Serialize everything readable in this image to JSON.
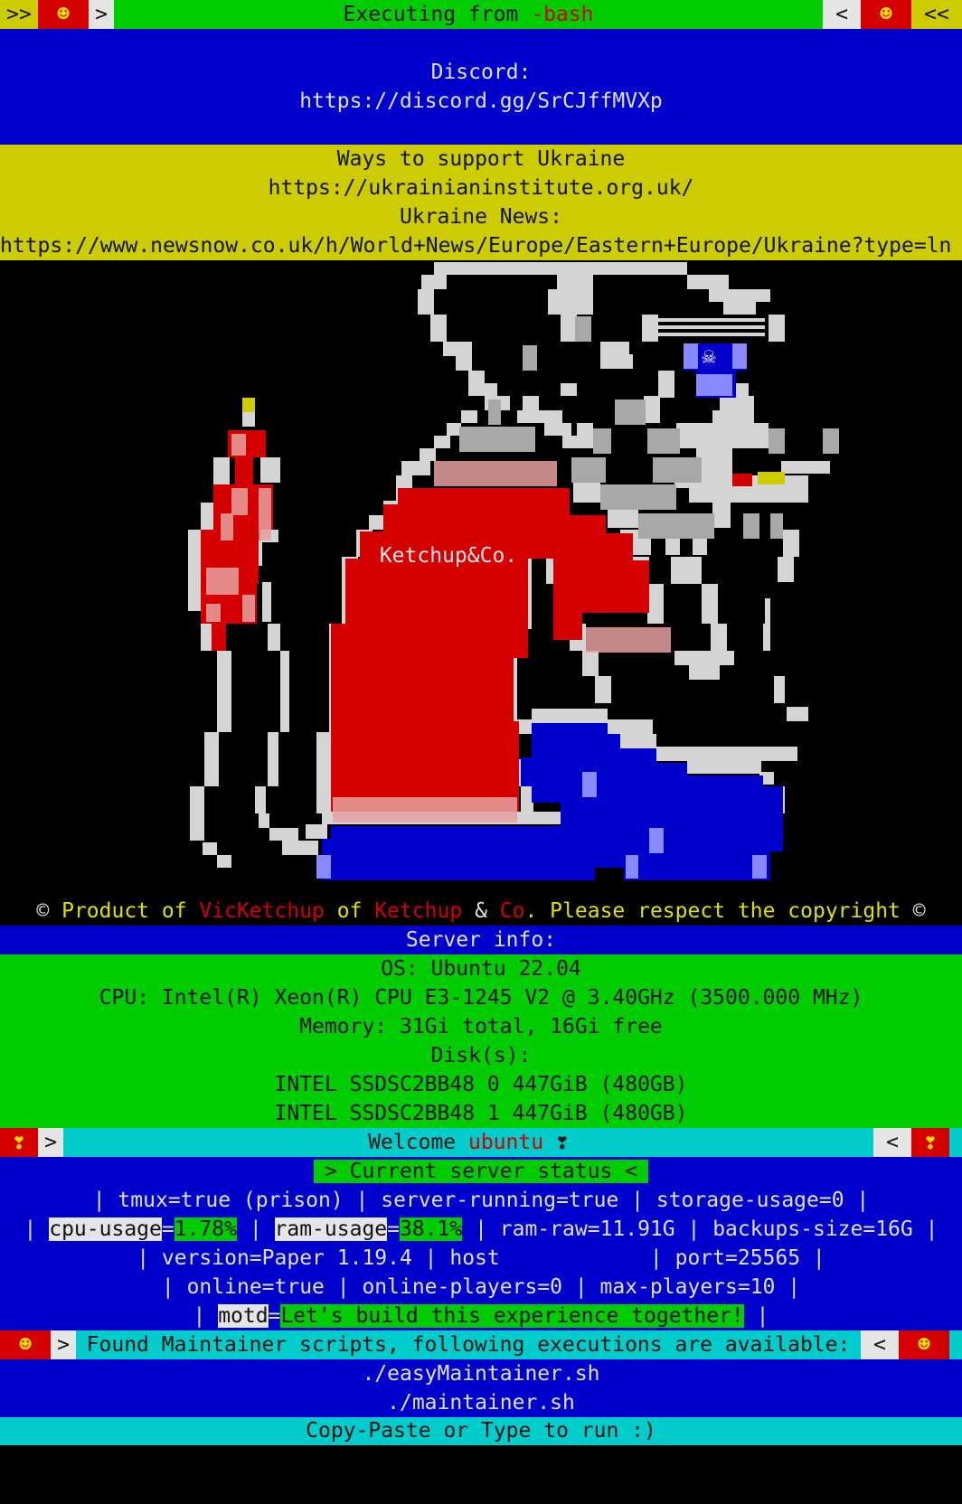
{
  "top_bar": {
    "left_arrows": ">>",
    "left_icon": "☻",
    "left_gt": ">",
    "title_prefix": "Executing from ",
    "title_shell": "-bash",
    "right_lt": "<",
    "right_icon": "☻",
    "right_arrows": "<<"
  },
  "discord": {
    "label": "Discord:",
    "url": "https://discord.gg/SrCJffMVXp"
  },
  "ukraine": {
    "line1": "Ways to support Ukraine",
    "line2": "https://ukrainianinstitute.org.uk/",
    "line3": "Ukraine News:",
    "line4": "https://www.newsnow.co.uk/h/World+News/Europe/Eastern+Europe/Ukraine?type=ln"
  },
  "art": {
    "label": "Ketchup&Co."
  },
  "copyright": {
    "p1": "© ",
    "p2": "Product of ",
    "p3": "VicKetchup",
    "p4": " of ",
    "p5": "Ketchup",
    "p6": " & ",
    "p7": "Co",
    "p8": ". Please respect the copyright ",
    "p9": "©"
  },
  "server_info": {
    "title": "Server info:",
    "os": "OS: Ubuntu 22.04",
    "cpu": "CPU: Intel(R) Xeon(R) CPU E3-1245 V2 @ 3.40GHz (3500.000 MHz)",
    "memory": "Memory: 31Gi total, 16Gi free",
    "disks_label": "Disk(s):",
    "disk0": "INTEL SSDSC2BB48 0 447GiB (480GB)",
    "disk1": "INTEL SSDSC2BB48 1 447GiB (480GB)"
  },
  "welcome": {
    "left_icon": "❣",
    "left_gt": ">",
    "text": "Welcome ",
    "user": "ubuntu",
    "heart": " ❣",
    "right_lt": "<",
    "right_icon": "❣"
  },
  "status": {
    "title": "> Current server status <",
    "line1": "| tmux=true (prison) | server-running=true | storage-usage=0 |",
    "l2_a": "| ",
    "l2_cpu_key": "cpu-usage",
    "l2_eq1": "=",
    "l2_cpu_val": "1.78%",
    "l2_mid": " | ",
    "l2_ram_key": "ram-usage",
    "l2_eq2": "=",
    "l2_ram_val": "38.1%",
    "l2_rest": " | ram-raw=11.91G | backups-size=16G |",
    "line3": "| version=Paper 1.19.4 | host            | port=25565 |",
    "line4": "| online=true | online-players=0 | max-players=10 |",
    "l5_a": "| ",
    "l5_key": "motd",
    "l5_eq": "=",
    "l5_val": "Let's build this experience together!",
    "l5_end": " |"
  },
  "maintainer": {
    "left_icon": "☻",
    "left_gt": ">",
    "text": "Found Maintainer scripts, following executions are available:",
    "right_lt": "<",
    "right_icon": "☻",
    "script1": "./easyMaintainer.sh",
    "script2": "./maintainer.sh",
    "footer": "Copy-Paste or Type to run :)"
  },
  "colors": {
    "blue": "#0000cc",
    "green": "#00cc00",
    "yellow": "#cccc00",
    "cyan": "#00cccc",
    "red": "#d40000"
  }
}
